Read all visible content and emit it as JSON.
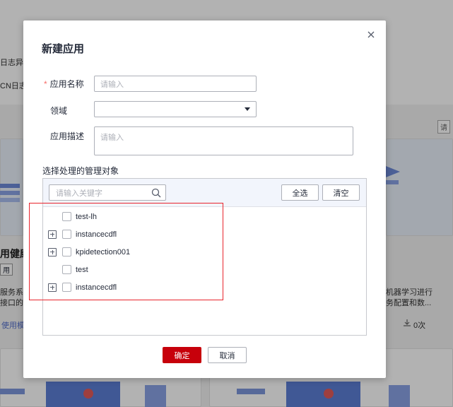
{
  "background": {
    "left_text_1": "日志异常",
    "left_text_2": "CN日志",
    "card_title": "用健康",
    "card_tag": "用",
    "card_desc_1": "服务系统",
    "card_desc_2": "接口的",
    "card_link": "使用模",
    "right_desc_1": "机器学习进行",
    "right_desc_2": "务配置和数...",
    "download_count": "0次",
    "right_btn": "请"
  },
  "modal": {
    "title": "新建应用",
    "fields": {
      "name_label": "应用名称",
      "name_required": "*",
      "name_placeholder": "请输入",
      "domain_label": "领域",
      "domain_value": "",
      "desc_label": "应用描述",
      "desc_placeholder": "请输入"
    },
    "objects_label": "选择处理的管理对象",
    "panel": {
      "search_placeholder": "请输入关键字",
      "select_all": "全选",
      "clear": "清空",
      "nodes": [
        {
          "label": "test-lh",
          "expandable": false
        },
        {
          "label": "instancecdfl",
          "expandable": true
        },
        {
          "label": "kpidetection001",
          "expandable": true
        },
        {
          "label": "test",
          "expandable": false
        },
        {
          "label": "instancecdfl",
          "expandable": true
        }
      ]
    },
    "confirm": "确定",
    "cancel": "取消"
  },
  "colors": {
    "primary_button": "#c7000b",
    "highlight_box": "#e8242c",
    "required_mark": "#f66f6a"
  },
  "icons": [
    "close-icon",
    "chevron-down-icon",
    "search-icon",
    "expand-icon",
    "download-icon"
  ]
}
